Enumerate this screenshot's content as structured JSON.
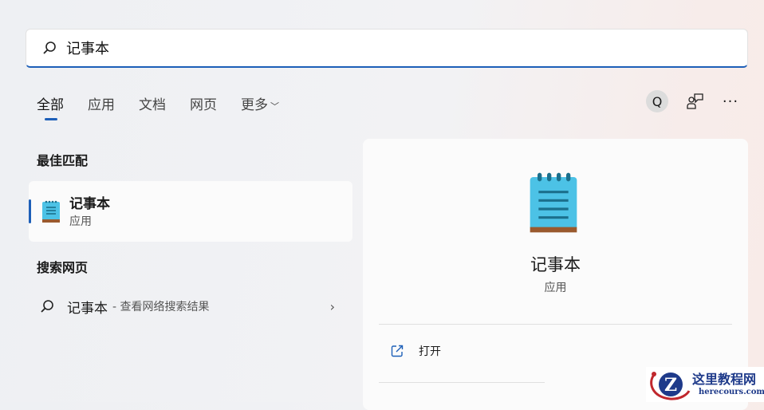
{
  "search": {
    "value": "记事本"
  },
  "tabs": [
    {
      "label": "全部"
    },
    {
      "label": "应用"
    },
    {
      "label": "文档"
    },
    {
      "label": "网页"
    },
    {
      "label": "更多"
    }
  ],
  "toolbar": {
    "avatar_letter": "Q",
    "more": "···"
  },
  "best_match": {
    "heading": "最佳匹配",
    "title": "记事本",
    "subtitle": "应用"
  },
  "web_search": {
    "heading": "搜索网页",
    "query": "记事本",
    "desc": "- 查看网络搜索结果"
  },
  "preview": {
    "title": "记事本",
    "subtitle": "应用",
    "actions": [
      {
        "label": "打开"
      }
    ]
  },
  "watermark": {
    "title": "这里教程网",
    "url": "herecours.com"
  },
  "colors": {
    "accent": "#1d5fb8"
  }
}
